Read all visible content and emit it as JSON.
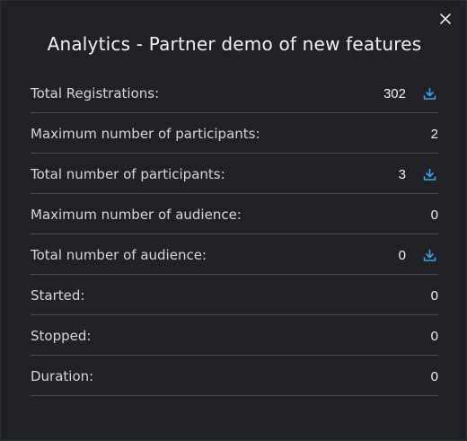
{
  "dialog": {
    "title": "Analytics - Partner demo of new features",
    "close_icon": "close-icon",
    "accent_color": "#3aa6e8"
  },
  "rows": [
    {
      "label": "Total Registrations:",
      "value": "302",
      "downloadable": true,
      "icon": "download-icon"
    },
    {
      "label": "Maximum number of participants:",
      "value": "2",
      "downloadable": false
    },
    {
      "label": "Total number of participants:",
      "value": "3",
      "downloadable": true,
      "icon": "download-icon"
    },
    {
      "label": "Maximum number of audience:",
      "value": "0",
      "downloadable": false
    },
    {
      "label": "Total number of audience:",
      "value": "0",
      "downloadable": true,
      "icon": "download-icon"
    },
    {
      "label": "Started:",
      "value": "0",
      "downloadable": false
    },
    {
      "label": "Stopped:",
      "value": "0",
      "downloadable": false
    },
    {
      "label": "Duration:",
      "value": "0",
      "downloadable": false
    }
  ]
}
